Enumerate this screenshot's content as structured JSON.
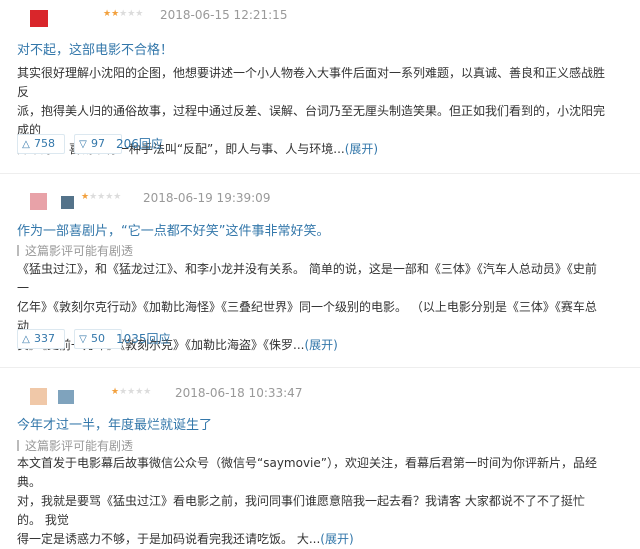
{
  "reviews": [
    {
      "stars_on": "★★",
      "stars_off": "★★★",
      "time": "2018-06-15 12:21:15",
      "title": "对不起，这部电影不合格！",
      "lines": [
        "其实很好理解小沈阳的企图，他想要讲述一个小人物卷入大事件后面对一系列难题，以真诚、善良和正义感战胜反",
        "派，抱得美人归的通俗故事，过程中通过反差、误解、台词乃至无厘头制造笑果。但正如我们看到的，小沈阳完成的",
        "并不好。 喜剧中有一种手法叫“反配”，即人与事、人与环境..."
      ],
      "more": "(展开)",
      "up": "758",
      "down": "97",
      "replies": "206回应",
      "avatar_color": "#d9262b"
    },
    {
      "stars_on": "★",
      "stars_off": "★★★★",
      "time": "2018-06-19 19:39:09",
      "title": "作为一部喜剧片，“它一点都不好笑”这件事非常好笑。",
      "spoiler": "这篇影评可能有剧透",
      "lines": [
        "《猛虫过江》，和《猛龙过江》、和李小龙并没有关系。 简单的说，这是一部和《三体》《汽车人总动员》《史前一",
        "亿年》《敦刻尔克行动》《加勒比海怪》《三叠纪世界》同一个级别的电影。 （以上电影分别是《三体》《赛车总动",
        "员》《史前一万年》《敦刻尔克》《加勒比海盗》《侏罗..."
      ],
      "more": "(展开)",
      "up": "337",
      "down": "50",
      "replies": "1035回应",
      "avatar_color": "#e8a2a8",
      "avatar_color_2": "#54738a"
    },
    {
      "stars_on": "★",
      "stars_off": "★★★★",
      "time": "2018-06-18 10:33:47",
      "title": "今年才过一半，年度最烂就诞生了",
      "spoiler": "这篇影评可能有剧透",
      "lines": [
        "本文首发于电影幕后故事微信公众号（微信号“saymovie”），欢迎关注，看幕后君第一时间为你评新片，品经典。",
        "对，我就是要骂《猛虫过江》看电影之前，我问同事们谁愿意陪我一起去看？我请客 大家都说不了不了挺忙的。 我觉",
        "得一定是诱惑力不够，于是加码说看完我还请吃饭。 大..."
      ],
      "more": "(展开)",
      "avatar_color": "#f0c8a8",
      "avatar_color_2": "#7fa3bd"
    }
  ],
  "icons": {
    "up": "triangle-up-icon",
    "down": "triangle-down-icon"
  }
}
